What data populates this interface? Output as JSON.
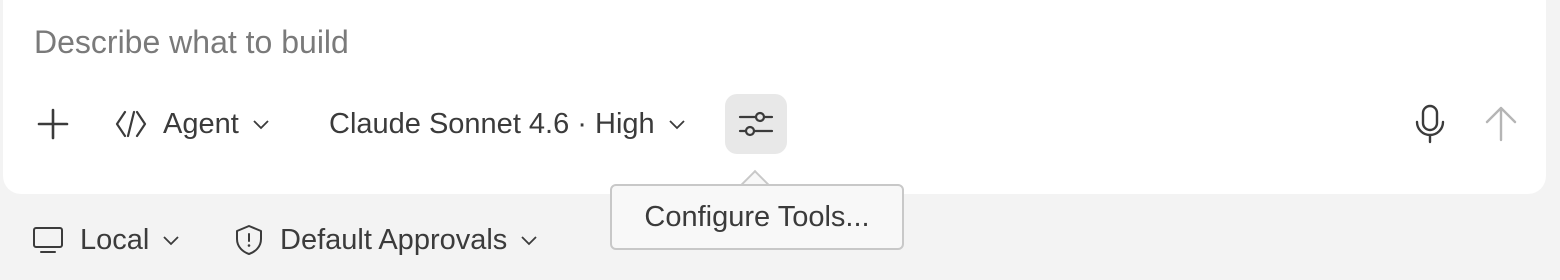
{
  "composer": {
    "placeholder": "Describe what to build",
    "add_icon": "plus-icon",
    "mode": {
      "label": "Agent",
      "icon": "agent-brackets-icon"
    },
    "model": {
      "label": "Claude Sonnet 4.6 · High"
    },
    "tools_icon": "sliders-icon",
    "mic_icon": "microphone-icon",
    "send_icon": "arrow-up-icon"
  },
  "tooltip": {
    "text": "Configure Tools..."
  },
  "footer": {
    "environment": {
      "label": "Local",
      "icon": "monitor-icon"
    },
    "approvals": {
      "label": "Default Approvals",
      "icon": "shield-icon"
    }
  },
  "colors": {
    "background": "#f3f3f3",
    "composer": "#ffffff",
    "tools_button_active": "#e8e8e8",
    "send_disabled": "#b5b5b5"
  }
}
